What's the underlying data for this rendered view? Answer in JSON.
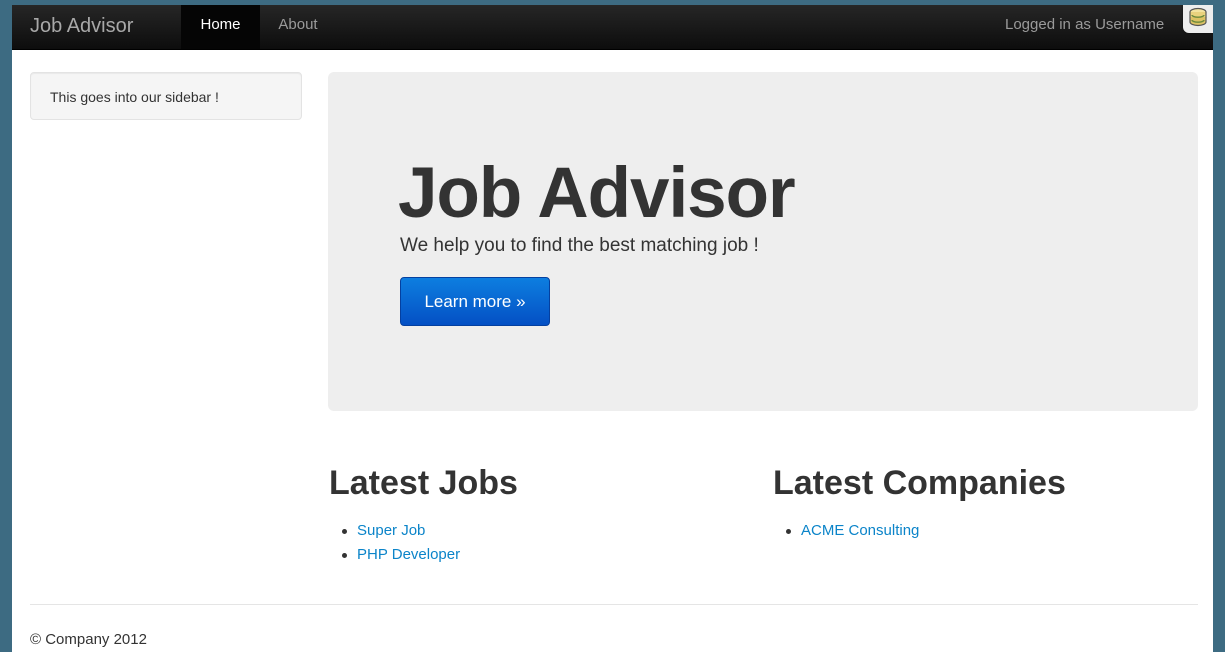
{
  "navbar": {
    "brand": "Job Advisor",
    "items": [
      {
        "label": "Home"
      },
      {
        "label": "About"
      }
    ],
    "login_text": "Logged in as Username",
    "db_icon": "database-icon"
  },
  "sidebar": {
    "text": "This goes into our sidebar !"
  },
  "hero": {
    "title": "Job Advisor",
    "subtitle": "We help you to find the best matching job !",
    "button_label": "Learn more »"
  },
  "latest_jobs": {
    "title": "Latest Jobs",
    "items": [
      {
        "label": "Super Job"
      },
      {
        "label": "PHP Developer"
      }
    ]
  },
  "latest_companies": {
    "title": "Latest Companies",
    "items": [
      {
        "label": "ACME Consulting"
      }
    ]
  },
  "footer": {
    "text": "© Company 2012"
  },
  "colors": {
    "navbar": "#1b1b1b",
    "link": "#0b84c9",
    "primary_button": "#0560d4",
    "hero_background": "#eeeeee",
    "desktop_background": "#3d6b82"
  }
}
